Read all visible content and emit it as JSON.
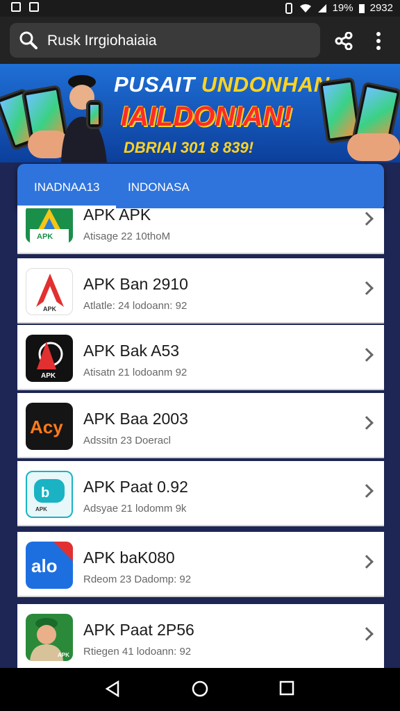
{
  "status": {
    "battery": "19%",
    "time": "2932"
  },
  "search": {
    "query": "Rusk Irrgiohaiaia"
  },
  "banner": {
    "line1a": "PUSAIT ",
    "line1b": "UNDONHAN",
    "line2": "IAILDONIAN!",
    "line3": "DBRIAI 301 8 839!"
  },
  "tabs": [
    {
      "label": "INADNAA13"
    },
    {
      "label": "INDONASA"
    }
  ],
  "apps": [
    {
      "title": "APK APK",
      "sub": "Atisage 22 10thoM",
      "icon": "apk-logo-icon",
      "color": "#1a8f4a"
    },
    {
      "title": "APK Ban 2910",
      "sub": "Atlatle: 24 lodoann: 92",
      "icon": "red-arrow-icon",
      "color": "#e23030"
    },
    {
      "title": "APK Bak A53",
      "sub": "Atisatn 21 lodoanm 92",
      "icon": "red-a-icon",
      "color": "#e23030"
    },
    {
      "title": "APK Baa 2003",
      "sub": "Adssitn 23 Doeracl",
      "icon": "orange-text-icon",
      "color": "#ff7a1a"
    },
    {
      "title": "APK Paat 0.92",
      "sub": "Adsyae 21 lodomm 9k",
      "icon": "teal-logo-icon",
      "color": "#19b3c4"
    },
    {
      "title": "APK baK080",
      "sub": "Rdeom 23 Dadomp: 92",
      "icon": "blue-red-icon",
      "color": "#1d6fe0"
    },
    {
      "title": "APK Paat 2P56",
      "sub": "Rtiegen 41 lodoann: 92",
      "icon": "man-avatar-icon",
      "color": "#2a8a3a"
    }
  ]
}
